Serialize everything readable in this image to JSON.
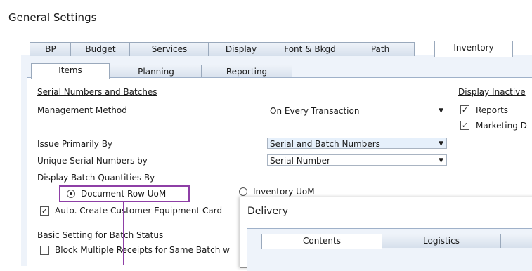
{
  "window": {
    "title": "General Settings"
  },
  "main_tabs": [
    "BP",
    "Budget",
    "Services",
    "Display",
    "Font & Bkgd",
    "Path",
    "Inventory"
  ],
  "sub_tabs": [
    "Items",
    "Planning",
    "Reporting"
  ],
  "serial_section": {
    "heading": "Serial Numbers and Batches",
    "management_method_label": "Management Method",
    "management_method_value": "On Every Transaction",
    "issue_primarily_label": "Issue Primarily By",
    "issue_primarily_value": "Serial and Batch Numbers",
    "unique_serial_label": "Unique Serial Numbers by",
    "unique_serial_value": "Serial Number",
    "display_batch_label": "Display Batch Quantities By",
    "radio_doc_row": "Document Row UoM",
    "radio_inventory": "Inventory UoM",
    "auto_create_label": "Auto. Create Customer Equipment Card",
    "basic_setting_label": "Basic Setting for Batch Status",
    "block_multiple_label": "Block Multiple Receipts for Same Batch w"
  },
  "display_inactive": {
    "heading": "Display Inactive",
    "reports_label": "Reports",
    "marketing_label": "Marketing D"
  },
  "popup": {
    "title": "Delivery",
    "tabs": [
      "Contents",
      "Logistics"
    ]
  },
  "colors": {
    "highlight": "#8e3fa6"
  }
}
